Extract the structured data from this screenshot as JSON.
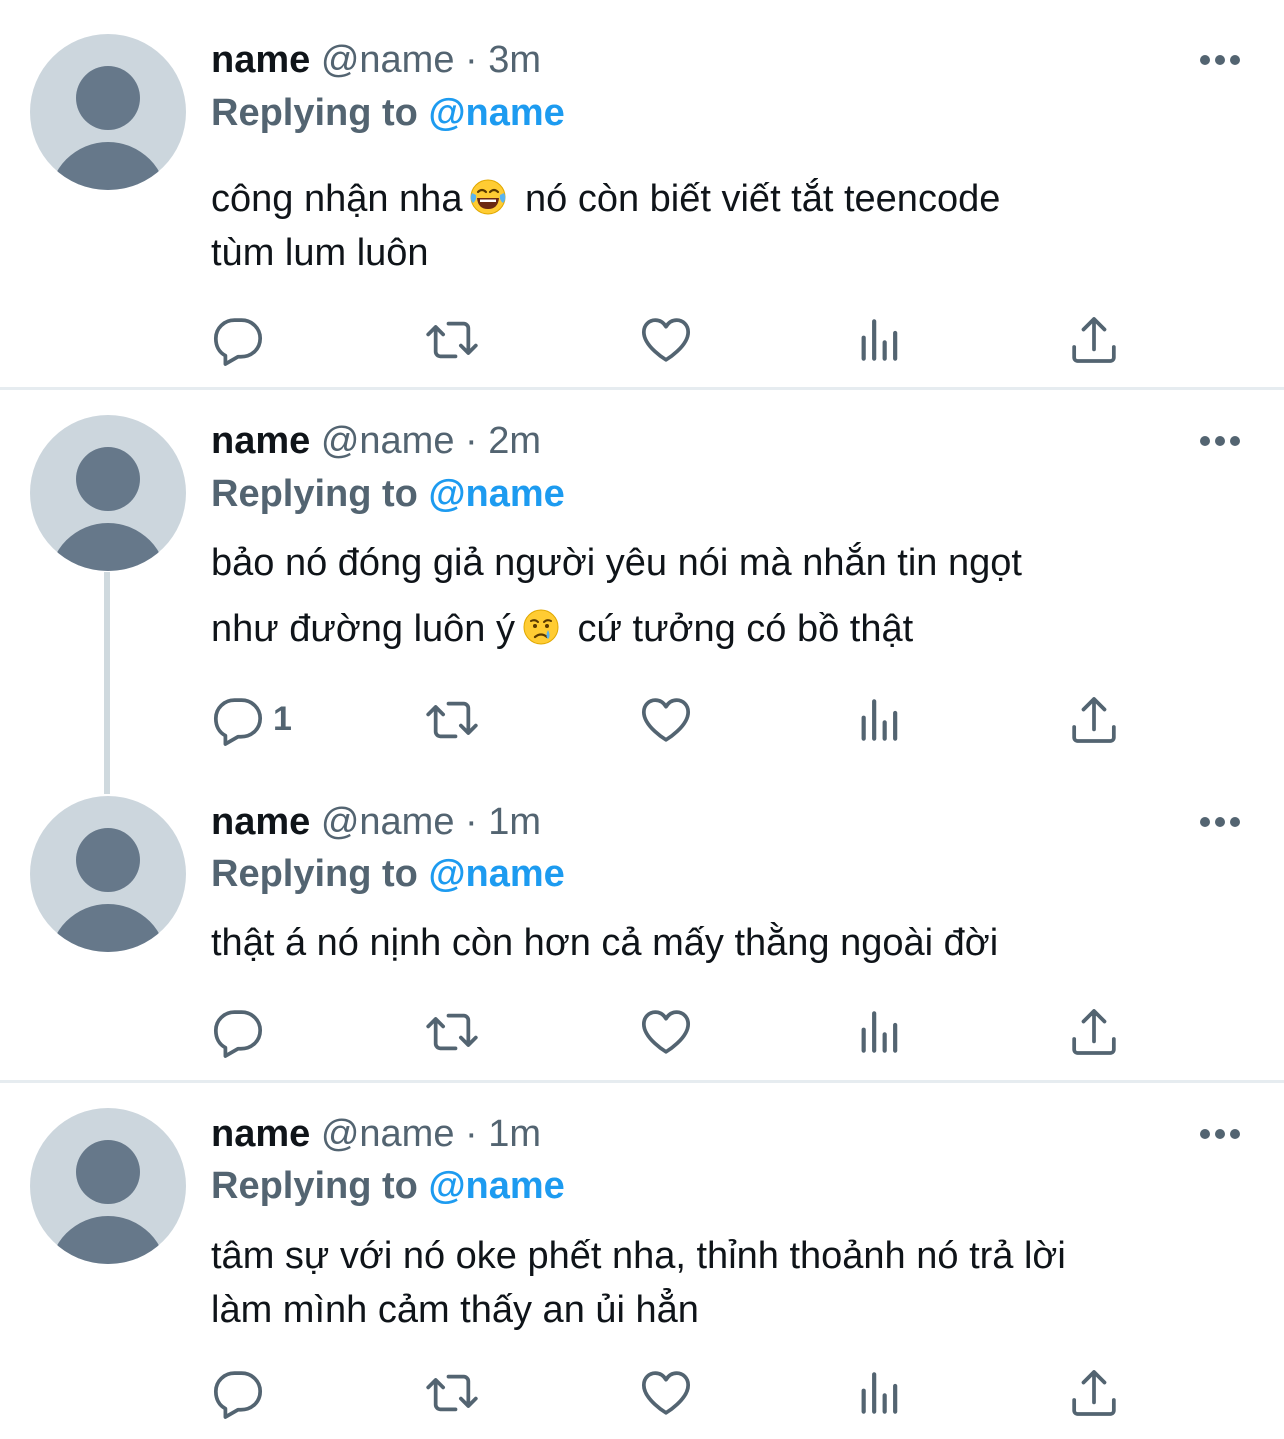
{
  "tweets": [
    {
      "name": "name",
      "handle": "@name",
      "time": "· 3m",
      "replying_prefix": "Replying to",
      "replying_handle": "@name",
      "text_parts": [
        "công nhận nha",
        " nó còn biết viết tắt teencode",
        "tùm lum luôn"
      ],
      "emoji": "face-with-tears-of-joy",
      "reply_count": ""
    },
    {
      "name": "name",
      "handle": "@name",
      "time": "· 2m",
      "replying_prefix": "Replying to",
      "replying_handle": "@name",
      "text_parts": [
        "bảo nó đóng giả người yêu nói mà nhắn tin ngọt",
        "như đường luôn ý",
        " cứ tưởng có bồ thật"
      ],
      "emoji": "crying-face",
      "reply_count": "1"
    },
    {
      "name": "name",
      "handle": "@name",
      "time": "· 1m",
      "replying_prefix": "Replying to",
      "replying_handle": "@name",
      "text_parts": [
        "thật á nó nịnh còn hơn cả mấy thằng ngoài đời"
      ],
      "reply_count": ""
    },
    {
      "name": "name",
      "handle": "@name",
      "time": "· 1m",
      "replying_prefix": "Replying to",
      "replying_handle": "@name",
      "text_parts": [
        "tâm sự với nó oke phết nha, thỉnh thoảnh nó trả lời",
        "làm mình cảm thấy an ủi hẳn"
      ],
      "reply_count": ""
    }
  ],
  "icons": {
    "reply": "reply-icon",
    "retweet": "retweet-icon",
    "like": "like-icon",
    "views": "views-icon",
    "share": "share-icon",
    "more": "more-icon"
  },
  "colors": {
    "text": "#0f1419",
    "secondary": "#536471",
    "link": "#1d9bf0",
    "avatar_bg": "#ccd6dd",
    "avatar_fg": "#66788a",
    "divider": "#e6ecf0"
  }
}
